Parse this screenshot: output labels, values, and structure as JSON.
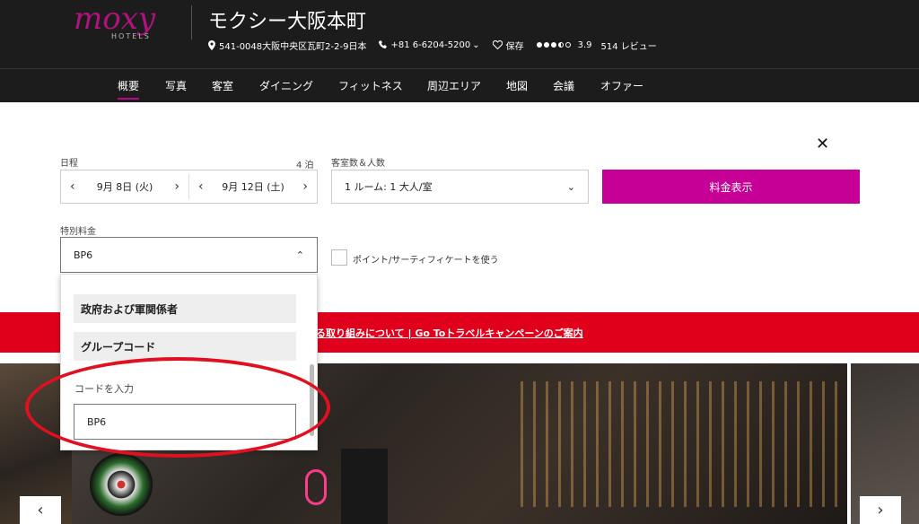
{
  "header": {
    "logo_text": "moxy",
    "logo_sub": "HOTELS",
    "hotel_name": "モクシー大阪本町",
    "address": "541-0048大阪中央区瓦町2-2-9日本",
    "phone": "+81 6-6204-5200",
    "save_label": "保存",
    "rating": "3.9",
    "reviews": "514 レビュー"
  },
  "nav": [
    "概要",
    "写真",
    "客室",
    "ダイニング",
    "フィットネス",
    "周辺エリア",
    "地図",
    "会議",
    "オファー"
  ],
  "form": {
    "dates_label": "日程",
    "nights": "4 泊",
    "checkin": "9月 8日 (火)",
    "checkout": "9月 12日 (土)",
    "rooms_label": "客室数＆人数",
    "rooms_value": "1 ルーム: 1 大人/室",
    "cta_label": "料金表示",
    "special_label": "特別料金",
    "special_value": "BP6",
    "points_label": "ポイント/サーティフィケートを使う"
  },
  "dropdown": {
    "items": [
      "政府および軍関係者",
      "グループコード"
    ],
    "code_label": "コードを入力",
    "code_value": "BP6"
  },
  "banner": {
    "text": "る取り組みについて | Go Toトラベルキャンペーンのご案内"
  },
  "colors": {
    "header_bg": "#1c1c1c",
    "accent": "#c60096",
    "banner": "#e0001b"
  }
}
